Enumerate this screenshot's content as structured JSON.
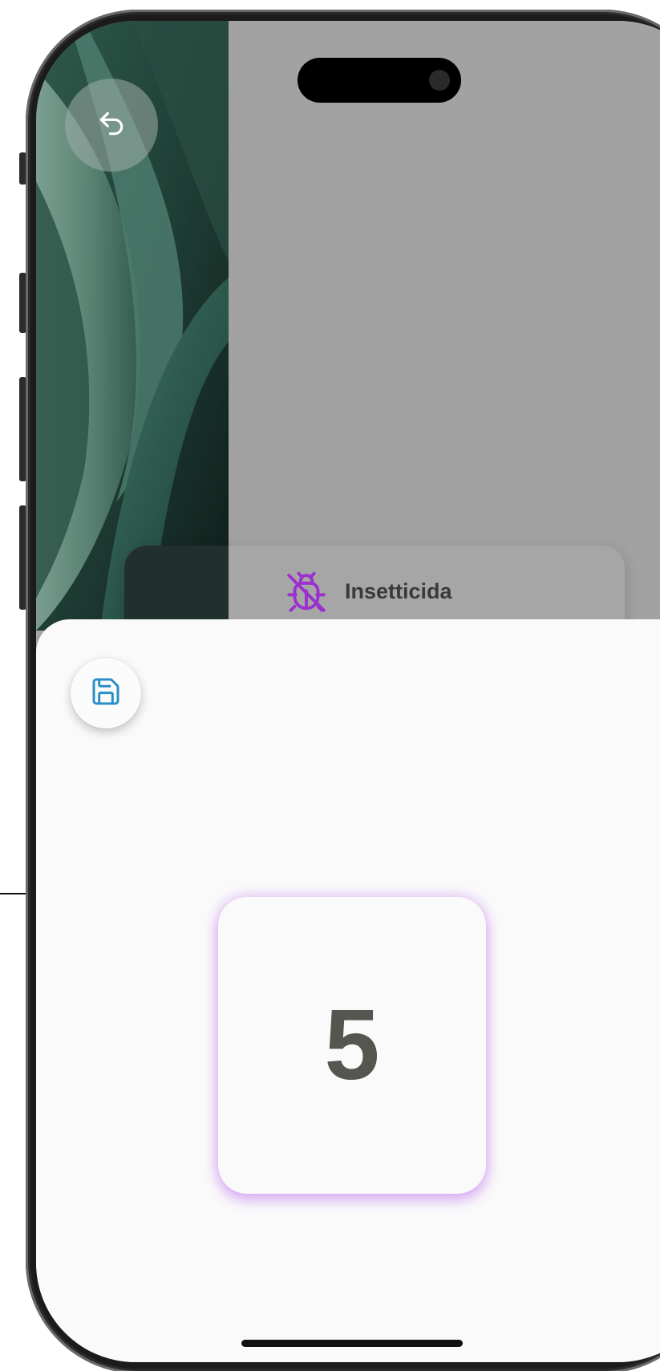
{
  "top_bar": {
    "back_icon": "undo-arrow-icon"
  },
  "background_card": {
    "label": "Insetticida",
    "icon": "bug-icon",
    "icon_color": "#9b2fd0"
  },
  "sheet": {
    "save_icon": "floppy-disk-icon",
    "save_icon_color": "#2a8fc7",
    "value": "5",
    "glow_color": "#c77df0"
  }
}
